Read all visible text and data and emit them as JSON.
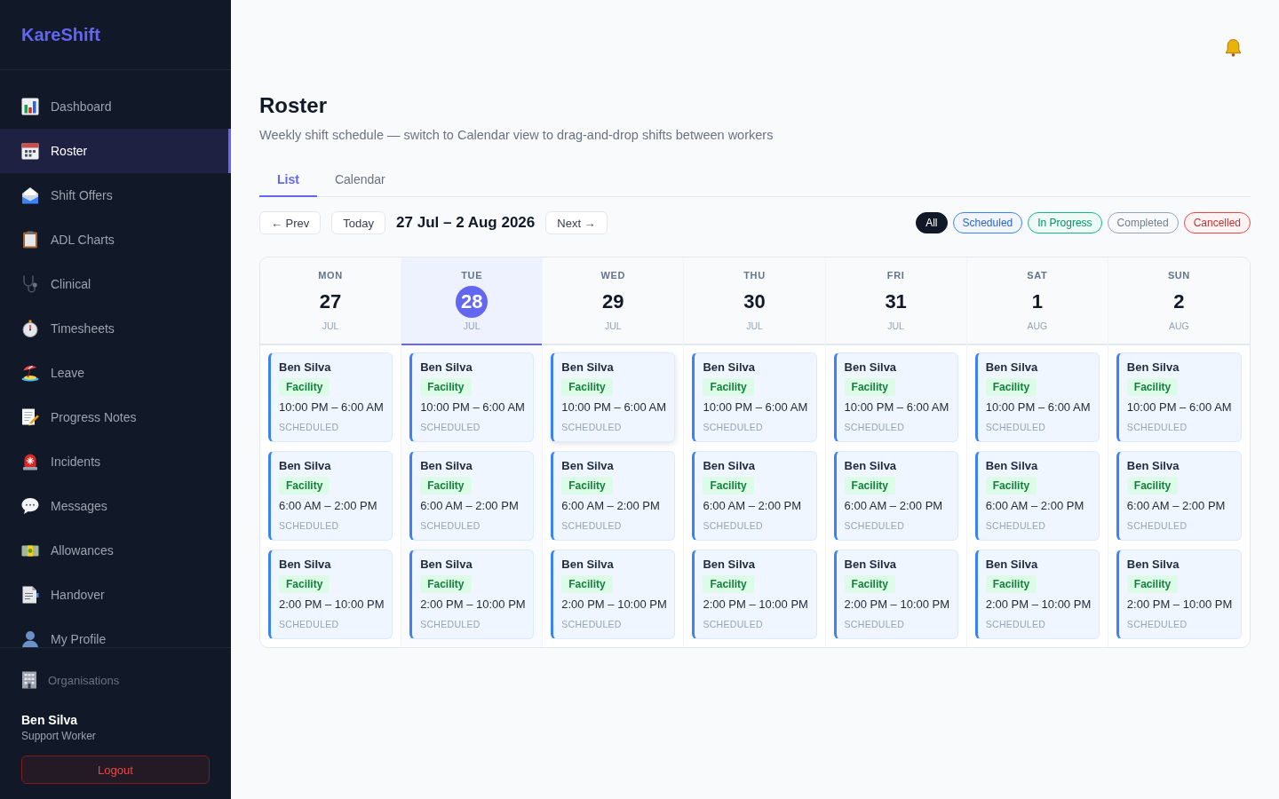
{
  "sidebar": {
    "brand": "KareShift",
    "nav": [
      {
        "label": "Dashboard",
        "selected": false
      },
      {
        "label": "Roster",
        "selected": true
      },
      {
        "label": "Shift Offers",
        "selected": false
      },
      {
        "label": "ADL Charts",
        "selected": false
      },
      {
        "label": "Clinical",
        "selected": false
      },
      {
        "label": "Timesheets",
        "selected": false
      },
      {
        "label": "Leave",
        "selected": false
      },
      {
        "label": "Progress Notes",
        "selected": false
      },
      {
        "label": "Incidents",
        "selected": false
      },
      {
        "label": "Messages",
        "selected": false
      },
      {
        "label": "Allowances",
        "selected": false
      },
      {
        "label": "Handover",
        "selected": false
      },
      {
        "label": "My Profile",
        "selected": false
      }
    ],
    "footer_link": "Organisations",
    "user": {
      "name": "Ben Silva",
      "role": "Support Worker"
    },
    "logout": "Logout"
  },
  "header": {
    "title": "Roster",
    "subtitle": "Weekly shift schedule — switch to Calendar view to drag-and-drop shifts between workers"
  },
  "tabs": [
    {
      "label": "List",
      "selected": true
    },
    {
      "label": "Calendar",
      "selected": false
    }
  ],
  "toolbar": {
    "prev": "← Prev",
    "today": "Today",
    "range": "27 Jul – 2 Aug 2026",
    "next": "Next →"
  },
  "filters": [
    {
      "label": "All",
      "selected": true,
      "color": "#111827"
    },
    {
      "label": "Scheduled",
      "selected": false,
      "color": "#3b82f6"
    },
    {
      "label": "In Progress",
      "selected": false,
      "color": "#10b981"
    },
    {
      "label": "Completed",
      "selected": false,
      "color": "#94a3b8"
    },
    {
      "label": "Cancelled",
      "selected": false,
      "color": "#ef4444"
    }
  ],
  "days": [
    {
      "weekday": "MON",
      "day": "27",
      "month": "JUL",
      "today": false,
      "shifts": [
        {
          "worker": "Ben Silva",
          "tag": "Facility",
          "time": "10:00 PM – 6:00 AM",
          "status": "SCHEDULED",
          "hovered": false
        },
        {
          "worker": "Ben Silva",
          "tag": "Facility",
          "time": "6:00 AM – 2:00 PM",
          "status": "SCHEDULED",
          "hovered": false
        },
        {
          "worker": "Ben Silva",
          "tag": "Facility",
          "time": "2:00 PM – 10:00 PM",
          "status": "SCHEDULED",
          "hovered": false
        }
      ]
    },
    {
      "weekday": "TUE",
      "day": "28",
      "month": "JUL",
      "today": true,
      "shifts": [
        {
          "worker": "Ben Silva",
          "tag": "Facility",
          "time": "10:00 PM – 6:00 AM",
          "status": "SCHEDULED",
          "hovered": false
        },
        {
          "worker": "Ben Silva",
          "tag": "Facility",
          "time": "6:00 AM – 2:00 PM",
          "status": "SCHEDULED",
          "hovered": false
        },
        {
          "worker": "Ben Silva",
          "tag": "Facility",
          "time": "2:00 PM – 10:00 PM",
          "status": "SCHEDULED",
          "hovered": false
        }
      ]
    },
    {
      "weekday": "WED",
      "day": "29",
      "month": "JUL",
      "today": false,
      "shifts": [
        {
          "worker": "Ben Silva",
          "tag": "Facility",
          "time": "10:00 PM – 6:00 AM",
          "status": "SCHEDULED",
          "hovered": true
        },
        {
          "worker": "Ben Silva",
          "tag": "Facility",
          "time": "6:00 AM – 2:00 PM",
          "status": "SCHEDULED",
          "hovered": false
        },
        {
          "worker": "Ben Silva",
          "tag": "Facility",
          "time": "2:00 PM – 10:00 PM",
          "status": "SCHEDULED",
          "hovered": false
        }
      ]
    },
    {
      "weekday": "THU",
      "day": "30",
      "month": "JUL",
      "today": false,
      "shifts": [
        {
          "worker": "Ben Silva",
          "tag": "Facility",
          "time": "10:00 PM – 6:00 AM",
          "status": "SCHEDULED",
          "hovered": false
        },
        {
          "worker": "Ben Silva",
          "tag": "Facility",
          "time": "6:00 AM – 2:00 PM",
          "status": "SCHEDULED",
          "hovered": false
        },
        {
          "worker": "Ben Silva",
          "tag": "Facility",
          "time": "2:00 PM – 10:00 PM",
          "status": "SCHEDULED",
          "hovered": false
        }
      ]
    },
    {
      "weekday": "FRI",
      "day": "31",
      "month": "JUL",
      "today": false,
      "shifts": [
        {
          "worker": "Ben Silva",
          "tag": "Facility",
          "time": "10:00 PM – 6:00 AM",
          "status": "SCHEDULED",
          "hovered": false
        },
        {
          "worker": "Ben Silva",
          "tag": "Facility",
          "time": "6:00 AM – 2:00 PM",
          "status": "SCHEDULED",
          "hovered": false
        },
        {
          "worker": "Ben Silva",
          "tag": "Facility",
          "time": "2:00 PM – 10:00 PM",
          "status": "SCHEDULED",
          "hovered": false
        }
      ]
    },
    {
      "weekday": "SAT",
      "day": "1",
      "month": "AUG",
      "today": false,
      "shifts": [
        {
          "worker": "Ben Silva",
          "tag": "Facility",
          "time": "10:00 PM – 6:00 AM",
          "status": "SCHEDULED",
          "hovered": false
        },
        {
          "worker": "Ben Silva",
          "tag": "Facility",
          "time": "6:00 AM – 2:00 PM",
          "status": "SCHEDULED",
          "hovered": false
        },
        {
          "worker": "Ben Silva",
          "tag": "Facility",
          "time": "2:00 PM – 10:00 PM",
          "status": "SCHEDULED",
          "hovered": false
        }
      ]
    },
    {
      "weekday": "SUN",
      "day": "2",
      "month": "AUG",
      "today": false,
      "shifts": [
        {
          "worker": "Ben Silva",
          "tag": "Facility",
          "time": "10:00 PM – 6:00 AM",
          "status": "SCHEDULED",
          "hovered": false
        },
        {
          "worker": "Ben Silva",
          "tag": "Facility",
          "time": "6:00 AM – 2:00 PM",
          "status": "SCHEDULED",
          "hovered": false
        },
        {
          "worker": "Ben Silva",
          "tag": "Facility",
          "time": "2:00 PM – 10:00 PM",
          "status": "SCHEDULED",
          "hovered": false
        }
      ]
    }
  ]
}
